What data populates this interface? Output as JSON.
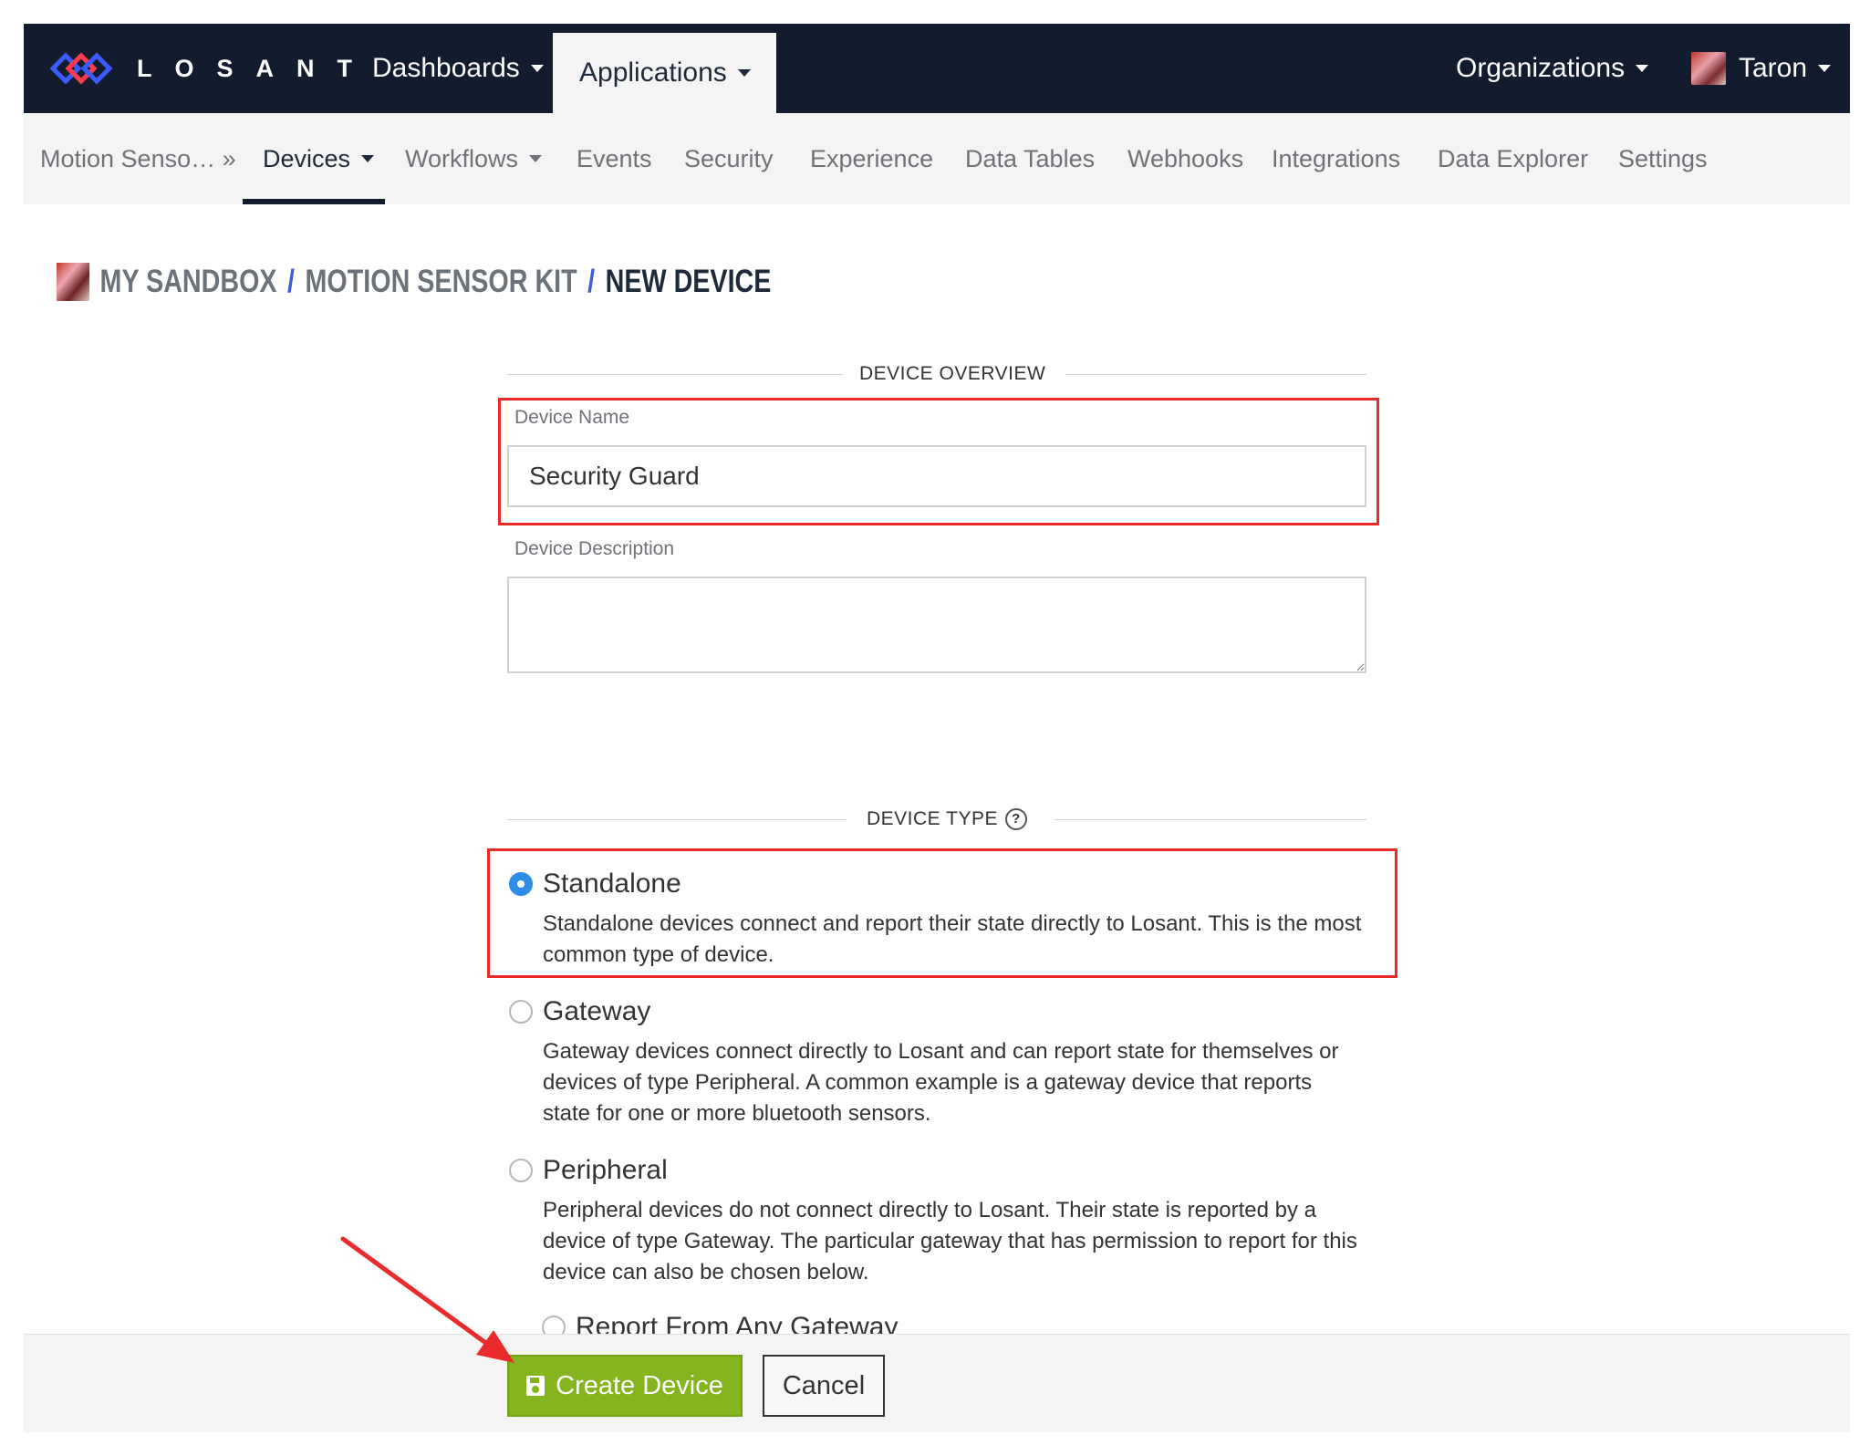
{
  "brand": {
    "name": "LOSANT"
  },
  "topnav": {
    "dashboards": "Dashboards",
    "applications": "Applications",
    "organizations": "Organizations",
    "user": "Taron"
  },
  "subnav": {
    "app_name": "Motion Senso… »",
    "items": [
      "Devices",
      "Workflows",
      "Events",
      "Security",
      "Experience",
      "Data Tables",
      "Webhooks",
      "Integrations",
      "Data Explorer",
      "Settings"
    ]
  },
  "breadcrumb": {
    "sandbox": "MY SANDBOX",
    "app": "MOTION SENSOR KIT",
    "current": "NEW DEVICE",
    "separator": "/"
  },
  "device_overview": {
    "header": "DEVICE OVERVIEW",
    "name_label": "Device Name",
    "name_value": "Security Guard",
    "description_label": "Device Description",
    "description_value": ""
  },
  "device_type": {
    "header": "DEVICE TYPE",
    "help_icon": "?",
    "options": [
      {
        "title": "Standalone",
        "description": "Standalone devices connect and report their state directly to Losant. This is the most common type of device.",
        "checked": true
      },
      {
        "title": "Gateway",
        "description": "Gateway devices connect directly to Losant and can report state for themselves or devices of type Peripheral. A common example is a gateway device that reports state for one or more bluetooth sensors.",
        "checked": false
      },
      {
        "title": "Peripheral",
        "description": "Peripheral devices do not connect directly to Losant. Their state is reported by a device of type Gateway. The particular gateway that has permission to report for this device can also be chosen below.",
        "checked": false
      }
    ],
    "sub_option": "Report From Any Gateway"
  },
  "footer": {
    "create_label": "Create Device",
    "cancel_label": "Cancel"
  },
  "colors": {
    "nav_bg": "#131b2e",
    "accent_blue": "#3f5bd8",
    "create_green": "#84b41e",
    "highlight_red": "#ea2b2b"
  }
}
